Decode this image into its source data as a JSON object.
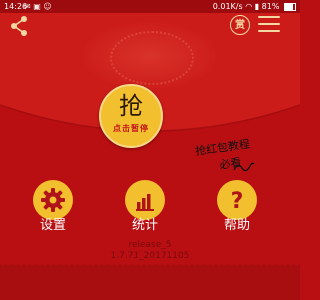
{
  "status_bar": {
    "time": "14:26",
    "network_speed": "0.01K/s",
    "battery_percent": "81%"
  },
  "header": {
    "reward_label": "赏"
  },
  "grab_button": {
    "main_label": "抢",
    "sub_label": "点击暂停"
  },
  "tutorial": {
    "line1": "抢红包教程",
    "line2": "必看"
  },
  "actions": [
    {
      "label": "设置",
      "icon": "gear-icon"
    },
    {
      "label": "统计",
      "icon": "bar-chart-icon"
    },
    {
      "label": "帮助",
      "icon": "question-icon"
    }
  ],
  "version": {
    "release": "release_5",
    "build": "1.7.71_20171105"
  },
  "colors": {
    "background": "#b90f12",
    "accent": "#f2bf2e"
  }
}
